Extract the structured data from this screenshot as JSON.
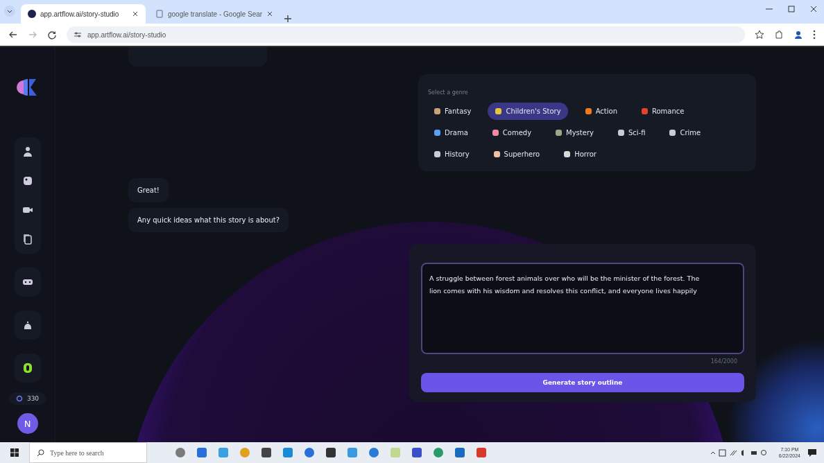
{
  "browser": {
    "tabs": [
      {
        "title": "app.artflow.ai/story-studio",
        "selected": true
      },
      {
        "title": "google translate - Google Sear",
        "selected": false
      }
    ],
    "url": "app.artflow.ai/story-studio"
  },
  "sidebar": {
    "credits": "330",
    "avatar_initial": "N"
  },
  "genre_picker": {
    "label": "Select a genre",
    "genres": [
      {
        "label": "Fantasy",
        "selected": false
      },
      {
        "label": "Children's Story",
        "selected": true
      },
      {
        "label": "Action",
        "selected": false
      },
      {
        "label": "Romance",
        "selected": false
      },
      {
        "label": "Drama",
        "selected": false
      },
      {
        "label": "Comedy",
        "selected": false
      },
      {
        "label": "Mystery",
        "selected": false
      },
      {
        "label": "Sci-fi",
        "selected": false
      },
      {
        "label": "Crime",
        "selected": false
      },
      {
        "label": "History",
        "selected": false
      },
      {
        "label": "Superhero",
        "selected": false
      },
      {
        "label": "Horror",
        "selected": false
      }
    ]
  },
  "messages": [
    {
      "text": "Great!"
    },
    {
      "text": "Any quick ideas what this story is about?"
    }
  ],
  "prompt": {
    "value": "A struggle between forest animals over who will be the minister of the forest. The lion comes with his wisdom and resolves this conflict, and everyone lives happily",
    "counter": "164/2000",
    "button": "Generate story outline"
  },
  "taskbar": {
    "search_placeholder": "Type here to search",
    "time": "7:10 PM",
    "date": "6/22/2024"
  }
}
